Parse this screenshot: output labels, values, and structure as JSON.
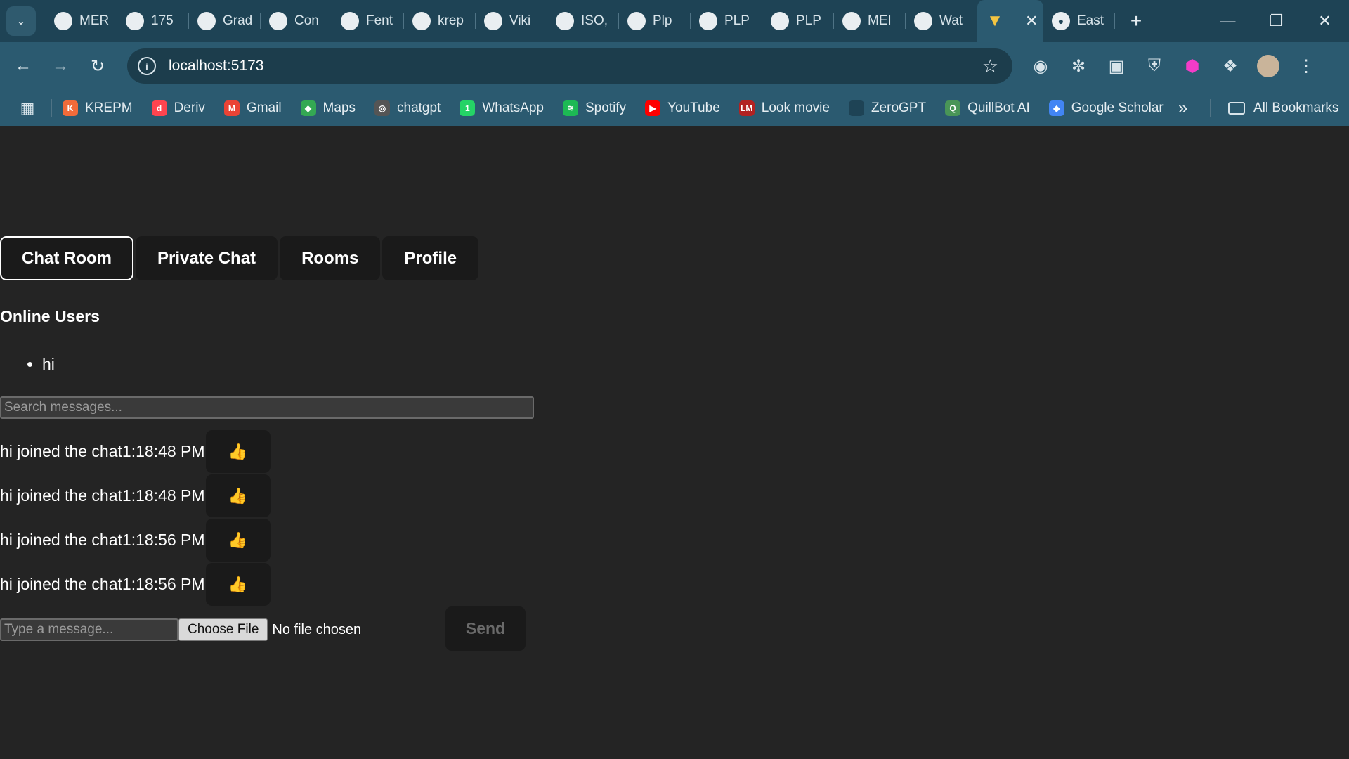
{
  "browser": {
    "tabs": [
      {
        "label": "MER",
        "icon": "document-icon"
      },
      {
        "label": "175",
        "icon": "globe-icon"
      },
      {
        "label": "Grad",
        "icon": "circle-x-icon"
      },
      {
        "label": "Con",
        "icon": "bowl-icon"
      },
      {
        "label": "Fent",
        "icon": "heart-icon"
      },
      {
        "label": "krep",
        "icon": "bolt-icon"
      },
      {
        "label": "Viki",
        "icon": "play-icon"
      },
      {
        "label": "ISO,",
        "icon": "user-circle-icon"
      },
      {
        "label": "Plp",
        "icon": "openai-icon"
      },
      {
        "label": "PLP",
        "icon": "feather-icon"
      },
      {
        "label": "PLP",
        "icon": "github-icon"
      },
      {
        "label": "MEI",
        "icon": "circle-check-icon"
      },
      {
        "label": "Wat",
        "icon": "play-triangle-icon"
      }
    ],
    "active_tab_icon": "vite-icon",
    "last_tab": {
      "label": "East",
      "icon": "globe-icon"
    },
    "url": "localhost:5173",
    "bookmarks": [
      {
        "label": "KREPM",
        "color": "#f26b3a",
        "glyph": "K"
      },
      {
        "label": "Deriv",
        "color": "#ff444f",
        "glyph": "d"
      },
      {
        "label": "Gmail",
        "color": "#ea4335",
        "glyph": "M"
      },
      {
        "label": "Maps",
        "color": "#34a853",
        "glyph": "◆"
      },
      {
        "label": "chatgpt",
        "color": "#555555",
        "glyph": "◎"
      },
      {
        "label": "WhatsApp",
        "color": "#25d366",
        "glyph": "1"
      },
      {
        "label": "Spotify",
        "color": "#1db954",
        "glyph": "≋"
      },
      {
        "label": "YouTube",
        "color": "#ff0000",
        "glyph": "▶"
      },
      {
        "label": "Look movie",
        "color": "#b22222",
        "glyph": "LM"
      },
      {
        "label": "ZeroGPT",
        "color": "#1e4355",
        "glyph": ""
      },
      {
        "label": "QuillBot AI",
        "color": "#499557",
        "glyph": "Q"
      },
      {
        "label": "Google Scholar",
        "color": "#4285f4",
        "glyph": "◆"
      }
    ],
    "all_bookmarks": "All Bookmarks"
  },
  "app": {
    "nav": [
      "Chat Room",
      "Private Chat",
      "Rooms",
      "Profile"
    ],
    "online_title": "Online Users",
    "online_users": [
      "hi"
    ],
    "search_placeholder": "Search messages...",
    "messages": [
      {
        "text": "hi joined the chat1:18:48 PM",
        "reaction": "👍"
      },
      {
        "text": "hi joined the chat1:18:48 PM",
        "reaction": "👍"
      },
      {
        "text": "hi joined the chat1:18:56 PM",
        "reaction": "👍"
      },
      {
        "text": "hi joined the chat1:18:56 PM",
        "reaction": "👍"
      }
    ],
    "message_placeholder": "Type a message...",
    "choose_file": "Choose File",
    "file_status": "No file chosen",
    "send": "Send"
  }
}
